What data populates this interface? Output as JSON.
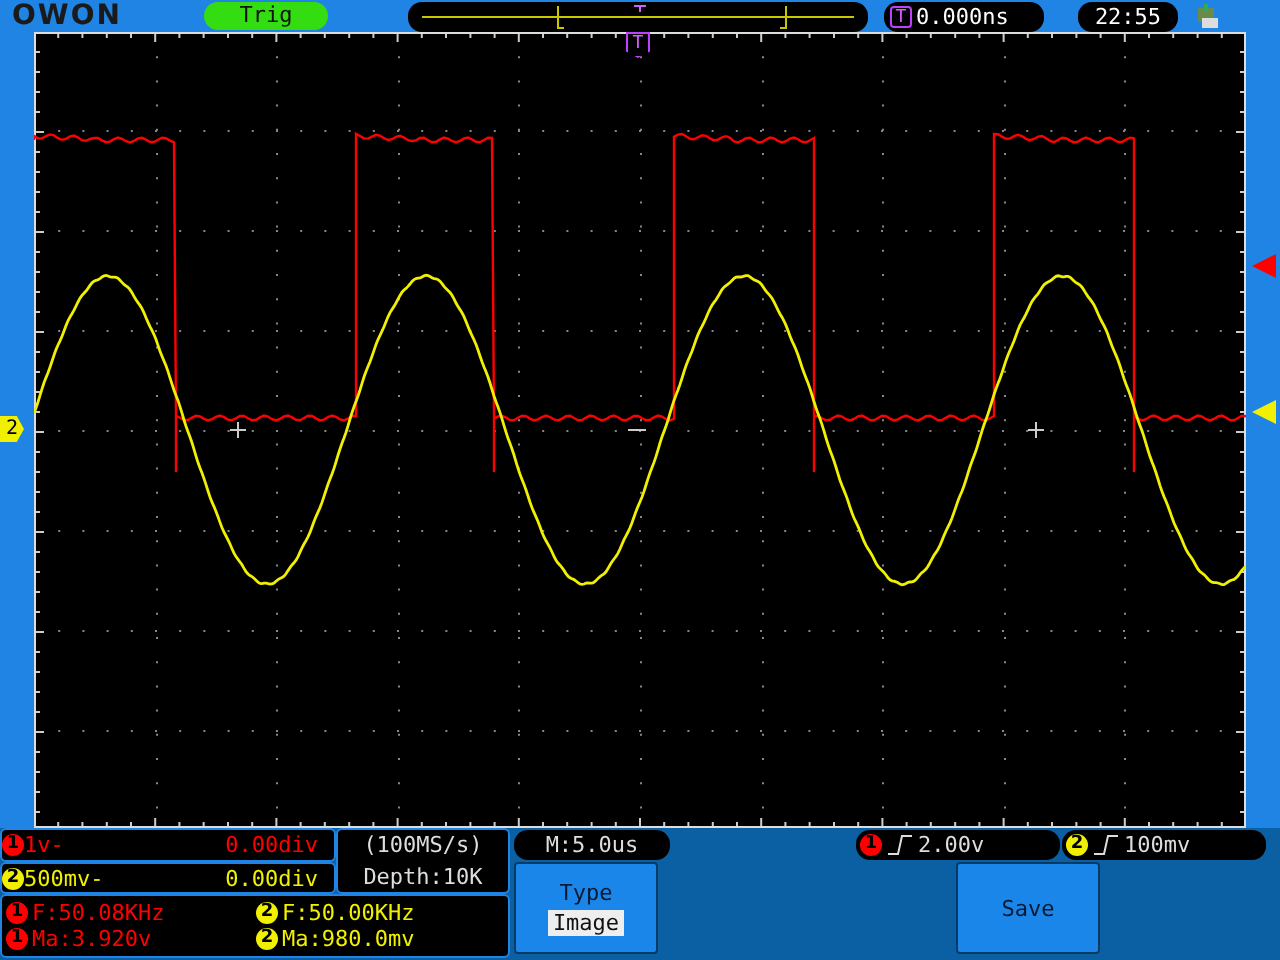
{
  "top_bar": {
    "logo": "OWON",
    "status": "Trig",
    "trigger_badge": "T",
    "trigger_position": "0.000ns",
    "time": "22:55"
  },
  "screen": {
    "trigger_marker": "T",
    "channel_marker": "2"
  },
  "channels": [
    {
      "badge": "1",
      "scale": "1v-",
      "offset": "0.00div",
      "color": "#ff0000"
    },
    {
      "badge": "2",
      "scale": "500mv-",
      "offset": "0.00div",
      "color": "#f0f000"
    }
  ],
  "acquisition": {
    "sample_rate": "(100MS/s)",
    "depth": "Depth:10K"
  },
  "measurements": [
    {
      "badge": "1",
      "text": "F:50.08KHz",
      "color": "#ff0000"
    },
    {
      "badge": "2",
      "text": "F:50.00KHz",
      "color": "#f0f000"
    },
    {
      "badge": "1",
      "text": "Ma:3.920v",
      "color": "#ff0000"
    },
    {
      "badge": "2",
      "text": "Ma:980.0mv",
      "color": "#f0f000"
    }
  ],
  "timebase": "M:5.0us",
  "triggers": [
    {
      "badge": "1",
      "value": "2.00v",
      "color": "#ff0000"
    },
    {
      "badge": "2",
      "value": "100mv",
      "color": "#f0f000"
    }
  ],
  "menu_buttons": [
    {
      "kind": "option",
      "label": "Type",
      "value": "Image"
    },
    {
      "kind": "action",
      "label": "Save"
    }
  ]
}
